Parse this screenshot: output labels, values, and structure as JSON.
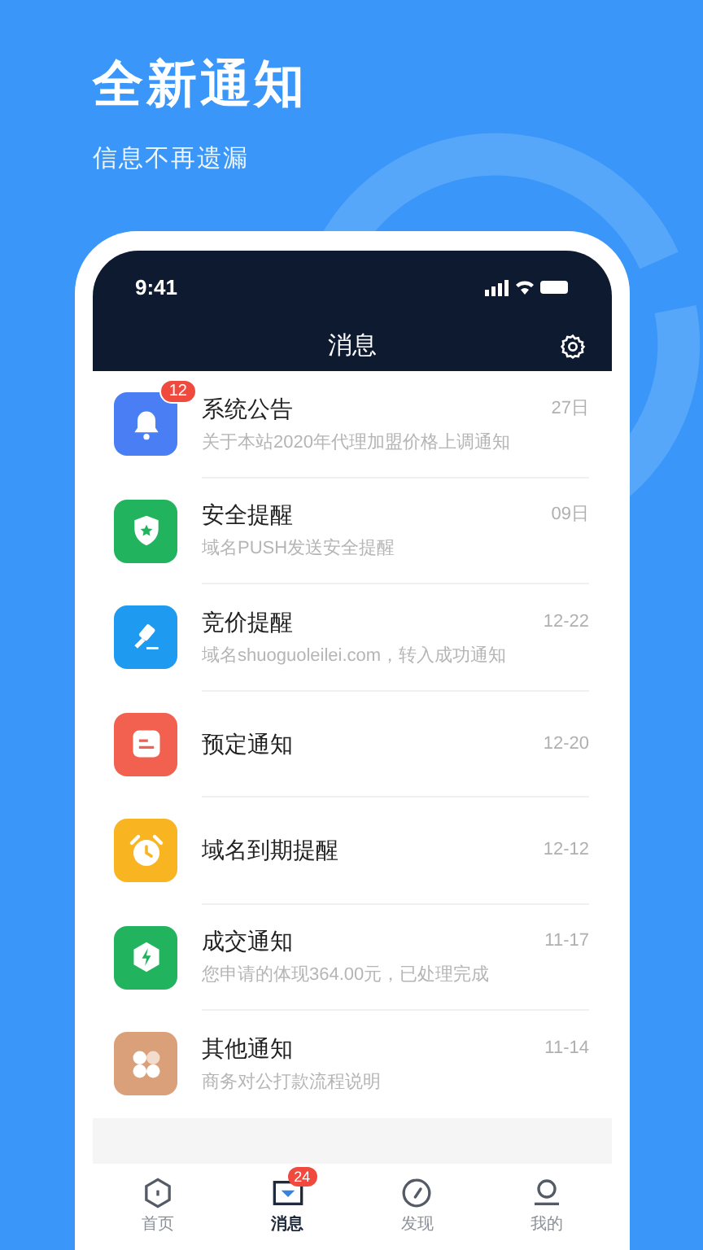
{
  "headline": "全新通知",
  "subtitle": "信息不再遗漏",
  "status_bar": {
    "time": "9:41"
  },
  "nav": {
    "title": "消息"
  },
  "messages": [
    {
      "kind": "bell",
      "color": "#4a7ef5",
      "title": "系统公告",
      "preview": "关于本站2020年代理加盟价格上调通知",
      "date": "27日",
      "badge": "12"
    },
    {
      "kind": "shield",
      "color": "#22b35e",
      "title": "安全提醒",
      "preview": "域名PUSH发送安全提醒",
      "date": "09日"
    },
    {
      "kind": "gavel",
      "color": "#1e9bf0",
      "title": "竞价提醒",
      "preview": "域名shuoguoleilei.com，转入成功通知",
      "date": "12-22"
    },
    {
      "kind": "note",
      "color": "#f2604f",
      "title": "预定通知",
      "date": "12-20"
    },
    {
      "kind": "clock",
      "color": "#f9b421",
      "title": "域名到期提醒",
      "date": "12-12"
    },
    {
      "kind": "bolt",
      "color": "#22b35e",
      "title": "成交通知",
      "preview": "您申请的体现364.00元，已处理完成",
      "date": "11-17"
    },
    {
      "kind": "grid",
      "color": "#d9a07a",
      "title": "其他通知",
      "preview": "商务对公打款流程说明",
      "date": "11-14"
    }
  ],
  "tabs": [
    {
      "kind": "home",
      "label": "首页",
      "selected": false
    },
    {
      "kind": "message",
      "label": "消息",
      "selected": true,
      "badge": "24"
    },
    {
      "kind": "discover",
      "label": "发现",
      "selected": false
    },
    {
      "kind": "me",
      "label": "我的",
      "selected": false
    }
  ]
}
